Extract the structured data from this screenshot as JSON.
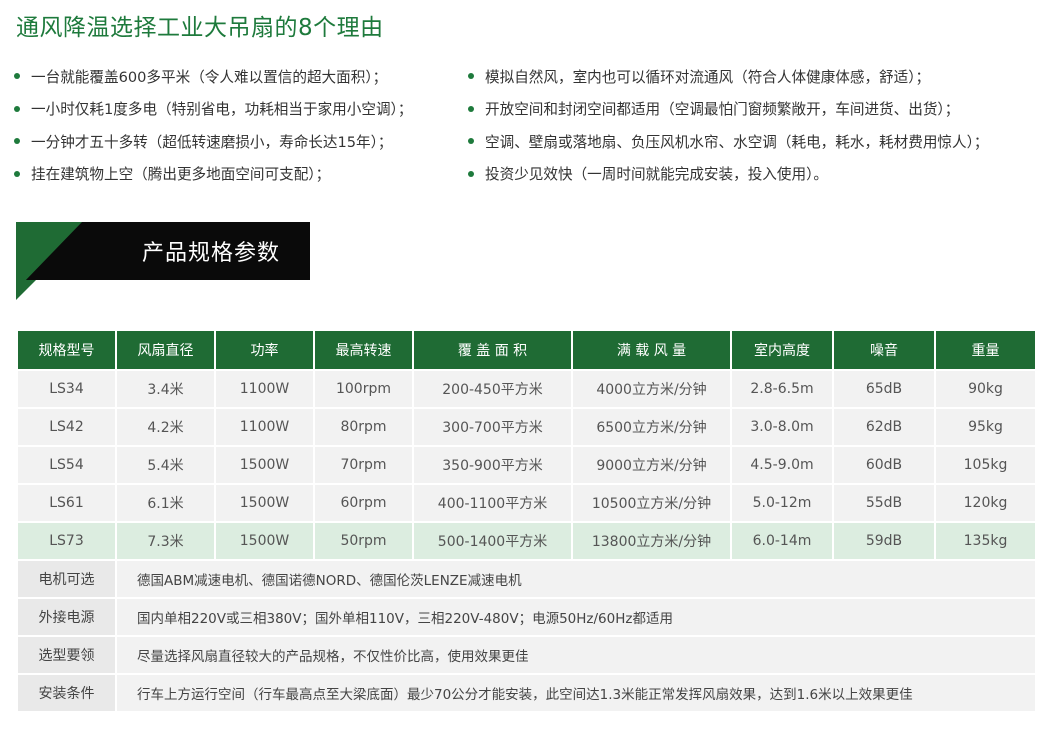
{
  "title": "通风降温选择工业大吊扇的8个理由",
  "reasons_left": [
    "一台就能覆盖600多平米（令人难以置信的超大面积）；",
    "一小时仅耗1度多电（特别省电，功耗相当于家用小空调）；",
    "一分钟才五十多转（超低转速磨损小，寿命长达15年）；",
    "挂在建筑物上空（腾出更多地面空间可支配）；"
  ],
  "reasons_right": [
    "模拟自然风，室内也可以循环对流通风（符合人体健康体感，舒适）；",
    "开放空间和封闭空间都适用（空调最怕门窗频繁敞开，车间进货、出货）；",
    "空调、壁扇或落地扇、负压风机水帘、水空调（耗电，耗水，耗材费用惊人）；",
    "投资少见效快（一周时间就能完成安装，投入使用）。"
  ],
  "section_title": "产品规格参数",
  "table": {
    "headers": [
      "规格型号",
      "风扇直径",
      "功率",
      "最高转速",
      "覆 盖 面 积",
      "满 载 风 量",
      "室内高度",
      "噪音",
      "重量"
    ],
    "rows": [
      [
        "LS34",
        "3.4米",
        "1100W",
        "100rpm",
        "200-450平方米",
        "4000立方米/分钟",
        "2.8-6.5m",
        "65dB",
        "90kg"
      ],
      [
        "LS42",
        "4.2米",
        "1100W",
        "80rpm",
        "300-700平方米",
        "6500立方米/分钟",
        "3.0-8.0m",
        "62dB",
        "95kg"
      ],
      [
        "LS54",
        "5.4米",
        "1500W",
        "70rpm",
        "350-900平方米",
        "9000立方米/分钟",
        "4.5-9.0m",
        "60dB",
        "105kg"
      ],
      [
        "LS61",
        "6.1米",
        "1500W",
        "60rpm",
        "400-1100平方米",
        "10500立方米/分钟",
        "5.0-12m",
        "55dB",
        "120kg"
      ],
      [
        "LS73",
        "7.3米",
        "1500W",
        "50rpm",
        "500-1400平方米",
        "13800立方米/分钟",
        "6.0-14m",
        "59dB",
        "135kg"
      ]
    ],
    "notes": [
      {
        "label": "电机可选",
        "text": "德国ABM减速电机、德国诺德NORD、德国伦茨LENZE减速电机"
      },
      {
        "label": "外接电源",
        "text": "国内单相220V或三相380V；国外单相110V，三相220V-480V；电源50Hz/60Hz都适用"
      },
      {
        "label": "选型要领",
        "text": "尽量选择风扇直径较大的产品规格，不仅性价比高，使用效果更佳"
      },
      {
        "label": "安装条件",
        "text": "行车上方运行空间（行车最高点至大梁底面）最少70公分才能安装，此空间达1.3米能正常发挥风扇效果，达到1.6米以上效果更佳"
      }
    ]
  },
  "colors": {
    "accent": "#1e7a3c",
    "header_bg": "#1f6b34",
    "highlight_row": "#dcede0"
  }
}
